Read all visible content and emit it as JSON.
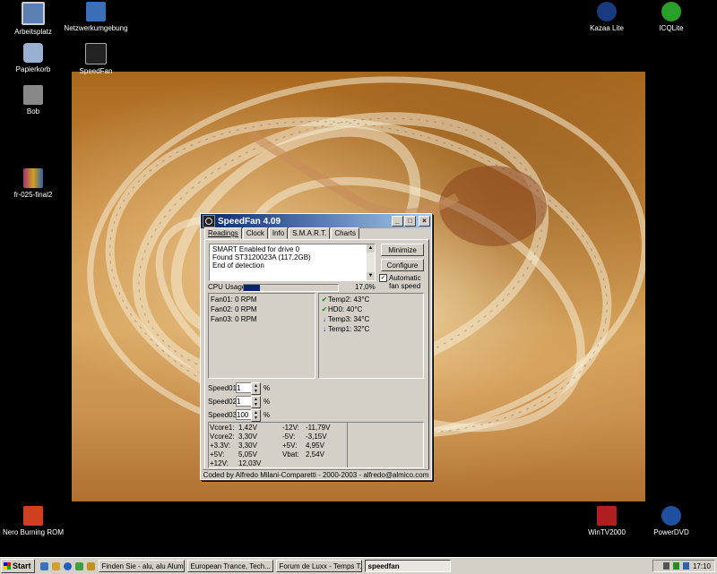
{
  "desktop_icons": [
    {
      "label": "Arbeitsplatz",
      "icon": "my-computer-icon"
    },
    {
      "label": "Netzwerkumgebung",
      "icon": "network-icon"
    },
    {
      "label": "Papierkorb",
      "icon": "recycle-bin-icon"
    },
    {
      "label": "SpeedFan",
      "icon": "speedfan-icon"
    },
    {
      "label": "Bob",
      "icon": "bob-icon"
    },
    {
      "label": "fr-025-final2",
      "icon": "archive-icon"
    },
    {
      "label": "Kazaa Lite",
      "icon": "kazaa-icon"
    },
    {
      "label": "ICQLite",
      "icon": "icq-icon"
    },
    {
      "label": "Nero Burning ROM",
      "icon": "nero-icon"
    },
    {
      "label": "WinTV2000",
      "icon": "wintv-icon"
    },
    {
      "label": "PowerDVD",
      "icon": "powerdvd-icon"
    }
  ],
  "window": {
    "title": "SpeedFan 4.09",
    "controls": [
      "_",
      "□",
      "×"
    ],
    "tabs": [
      "Readings",
      "Clock",
      "Info",
      "S.M.A.R.T.",
      "Charts"
    ],
    "log_lines": [
      "SMART Enabled for drive 0",
      "Found ST3120023A (117,2GB)",
      "End of detection"
    ],
    "buttons": {
      "minimize": "Minimize",
      "configure": "Configure"
    },
    "auto_fan": {
      "label_line1": "Automatic",
      "label_line2": "fan speed",
      "checked": true
    },
    "cpu": {
      "label": "CPU Usage",
      "value_text": "17,0%",
      "fraction": 0.17
    },
    "fans": [
      "Fan01: 0 RPM",
      "Fan02: 0 RPM",
      "Fan03: 0 RPM"
    ],
    "temps": [
      {
        "text": "Temp2: 43°C",
        "status": "ok"
      },
      {
        "text": "HD0:   40°C",
        "status": "ok"
      },
      {
        "text": "Temp3: 34°C",
        "status": "down"
      },
      {
        "text": "Temp1: 32°C",
        "status": "down"
      }
    ],
    "speeds": [
      {
        "label": "Speed01:",
        "value": "1"
      },
      {
        "label": "Speed02:",
        "value": "1"
      },
      {
        "label": "Speed03:",
        "value": "100"
      }
    ],
    "percent_sign": "%",
    "voltages_left": [
      {
        "name": "Vcore1:",
        "value": "1,42V"
      },
      {
        "name": "Vcore2:",
        "value": "3,30V"
      },
      {
        "name": "+3.3V:",
        "value": "3,30V"
      },
      {
        "name": "+5V:",
        "value": "5,05V"
      },
      {
        "name": "+12V:",
        "value": "12,03V"
      }
    ],
    "voltages_right": [
      {
        "name": "-12V:",
        "value": "-11,79V"
      },
      {
        "name": "-5V:",
        "value": "-3,15V"
      },
      {
        "name": "+5V:",
        "value": "4,95V"
      },
      {
        "name": "Vbat:",
        "value": "2,54V"
      }
    ],
    "footer": "Coded by Alfredo Milani-Comparetti - 2000-2003 - alfredo@almico.com"
  },
  "taskbar": {
    "start_label": "Start",
    "tasks": [
      {
        "label": "Finden Sie - alu, alu Alumi..."
      },
      {
        "label": "European Trance, Tech..."
      },
      {
        "label": "Forum de Luxx - Temps T..."
      },
      {
        "label": "speedfan"
      }
    ],
    "clock": "17:10"
  }
}
